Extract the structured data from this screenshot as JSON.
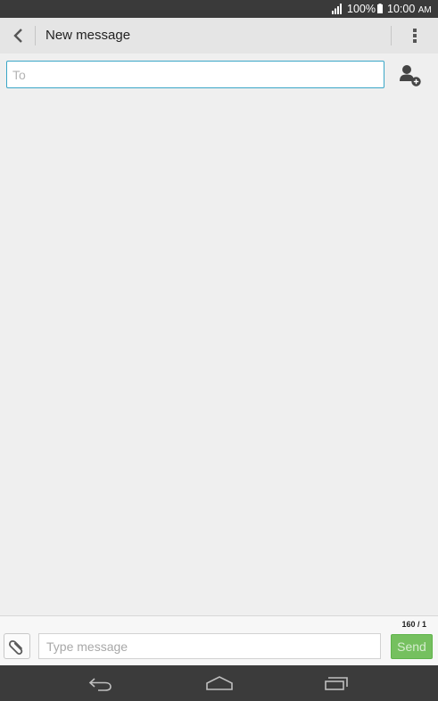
{
  "status_bar": {
    "battery_percent": "100%",
    "time": "10:00",
    "time_suffix": "AM",
    "icons": [
      "signal-icon",
      "battery-icon"
    ]
  },
  "header": {
    "title": "New message",
    "back_icon": "chevron-left-icon",
    "menu_icon": "overflow-menu-icon"
  },
  "recipient": {
    "placeholder": "To",
    "value": "",
    "add_contact_icon": "add-contact-icon"
  },
  "composer": {
    "counter": "160 / 1",
    "placeholder": "Type message",
    "value": "",
    "send_label": "Send",
    "attach_icon": "paperclip-icon"
  },
  "nav_bar": {
    "icons": [
      "back-icon",
      "home-icon",
      "recent-apps-icon"
    ]
  },
  "colors": {
    "accent": "#3aa6c7",
    "send_button": "#75c05f",
    "status_bar": "#3a3a3a",
    "action_bar": "#e5e5e5",
    "background": "#efefef"
  }
}
